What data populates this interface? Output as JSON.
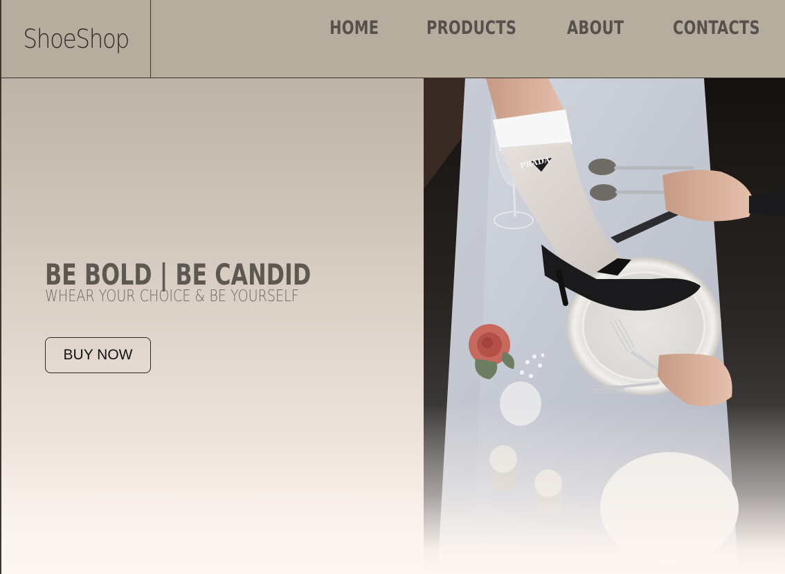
{
  "header": {
    "logo": "ShoeShop",
    "nav": {
      "home": "HOME",
      "products": "PRODUCTS",
      "about": "ABOUT",
      "contacts": "CONTACTS"
    }
  },
  "hero": {
    "title": "BE BOLD | BE CANDID",
    "subtitle": "WHEAR YOUR CHOICE & BE YOURSELF",
    "cta": "BUY NOW",
    "image": {
      "description": "hero-photo-heel-on-dinner-plate",
      "sock_brand_text": "PRADA"
    }
  },
  "colors": {
    "header_bg": "#b6ad9f",
    "nav_text": "#56514c",
    "title_text": "#5e5853",
    "page_bottom": "#fdf6f1"
  }
}
